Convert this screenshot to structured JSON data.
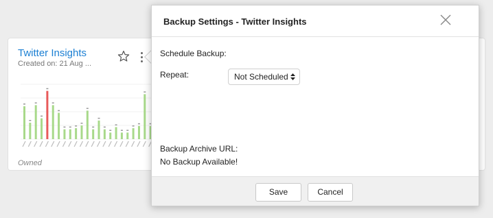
{
  "card": {
    "title": "Twitter Insights",
    "subtitle": "Created on: 21 Aug ...",
    "owned_label": "Owned",
    "star_icon": "star-outline-icon"
  },
  "chart_data": {
    "type": "bar",
    "values": [
      60,
      30,
      62,
      38,
      88,
      62,
      48,
      18,
      18,
      20,
      25,
      52,
      18,
      34,
      18,
      12,
      22,
      12,
      12,
      20,
      24,
      82,
      24
    ],
    "highlight_index": 4,
    "colors": {
      "normal": "#a8d98a",
      "highlight": "#e85a5a"
    },
    "ylim": [
      0,
      100
    ]
  },
  "modal": {
    "title": "Backup Settings - Twitter Insights",
    "schedule_label": "Schedule Backup:",
    "repeat_label": "Repeat:",
    "repeat_value": "Not Scheduled",
    "archive_label": "Backup Archive URL:",
    "archive_value": "No Backup Available!",
    "save_label": "Save",
    "cancel_label": "Cancel"
  }
}
